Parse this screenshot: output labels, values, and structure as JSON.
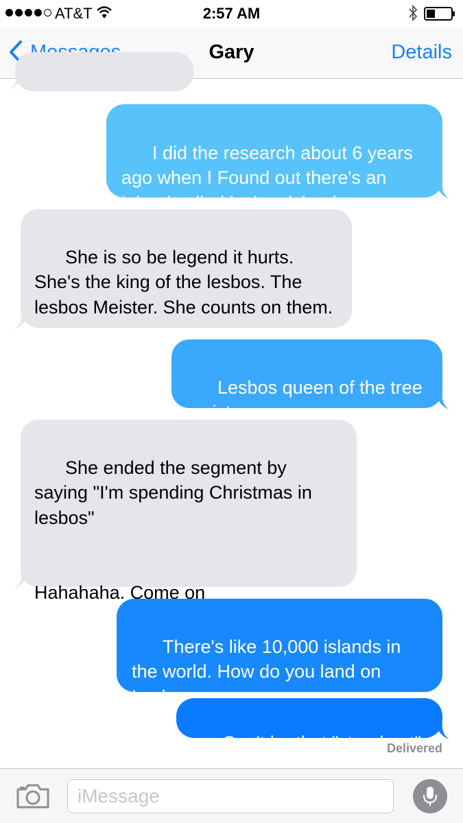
{
  "status_bar": {
    "carrier": "AT&T",
    "time": "2:57 AM",
    "signal_bars_filled": 4,
    "signal_bars_total": 5,
    "icons": [
      "signal-dots-icon",
      "wifi-icon",
      "bluetooth-icon",
      "battery-icon"
    ]
  },
  "nav": {
    "back_label": "Messages",
    "title": "Gary",
    "details_label": "Details",
    "accent_color": "#1a82fb"
  },
  "colors": {
    "incoming_bubble": "#e5e5ea",
    "outgoing_gradient_top": "#5ac8fa",
    "outgoing_gradient_bottom": "#0a7aff"
  },
  "messages": [
    {
      "from": "other",
      "text": ""
    },
    {
      "from": "me",
      "text": "I did the research about 6 years ago when I Found out there's an Island called lesbos island"
    },
    {
      "from": "other",
      "text": "She is so be legend it hurts. She's the king of the lesbos. The lesbos Meister. She counts on them."
    },
    {
      "from": "me",
      "text": "Lesbos queen of the tree meistas"
    },
    {
      "from": "other",
      "text": "She ended the segment by saying \"I'm spending Christmas in lesbos\"\n\n\nHahahaha. Come on"
    },
    {
      "from": "me",
      "text": "There's like 10,000 islands in the world. How do you land on Lesbos."
    },
    {
      "from": "me",
      "text": "Can't be that \"stand out\""
    }
  ],
  "delivered_label": "Delivered",
  "composer": {
    "placeholder": "iMessage",
    "value": "",
    "icons": [
      "camera-icon",
      "microphone-icon"
    ]
  }
}
